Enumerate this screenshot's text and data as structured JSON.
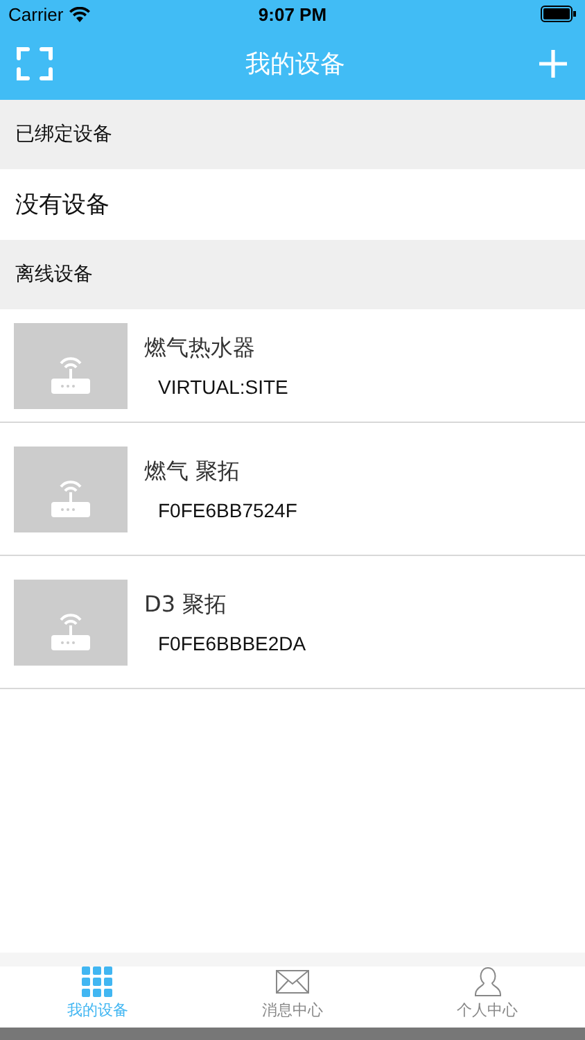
{
  "status_bar": {
    "carrier": "Carrier",
    "time": "9:07 PM"
  },
  "nav": {
    "title": "我的设备"
  },
  "bound_section": {
    "title": "已绑定设备",
    "empty_text": "没有设备"
  },
  "offline_section": {
    "title": "离线设备"
  },
  "devices": [
    {
      "name": "燃气热水器",
      "id": "VIRTUAL:SITE"
    },
    {
      "name": "燃气 聚拓",
      "id": "F0FE6BB7524F"
    },
    {
      "name": "D3 聚拓",
      "id": "F0FE6BBBE2DA"
    }
  ],
  "tabs": [
    {
      "label": "我的设备",
      "kind": "grid",
      "selected": true
    },
    {
      "label": "消息中心",
      "kind": "mail",
      "selected": false
    },
    {
      "label": "个人中心",
      "kind": "person",
      "selected": false
    }
  ]
}
